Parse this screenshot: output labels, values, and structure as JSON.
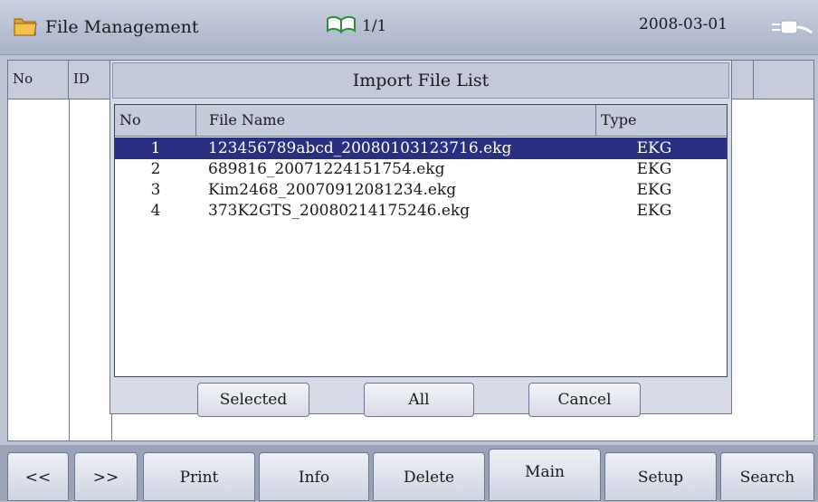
{
  "header": {
    "title": "File Management",
    "page_indicator": "1/1",
    "date": "2008-03-01",
    "icons": [
      "folder-icon",
      "book-icon",
      "power-plug-icon"
    ]
  },
  "background_table": {
    "columns": [
      "No",
      "ID",
      "",
      ""
    ]
  },
  "dialog": {
    "title": "Import File List",
    "columns": [
      "No",
      "File Name",
      "Type"
    ],
    "rows": [
      {
        "no": "1",
        "name": "123456789abcd_20080103123716.ekg",
        "type": "EKG",
        "selected": true
      },
      {
        "no": "2",
        "name": "689816_20071224151754.ekg",
        "type": "EKG",
        "selected": false
      },
      {
        "no": "3",
        "name": "Kim2468_20070912081234.ekg",
        "type": "EKG",
        "selected": false
      },
      {
        "no": "4",
        "name": "373K2GTS_20080214175246.ekg",
        "type": "EKG",
        "selected": false
      }
    ],
    "buttons": {
      "selected": "Selected",
      "all": "All",
      "cancel": "Cancel"
    }
  },
  "bottom_buttons": [
    "<<",
    ">>",
    "Print",
    "Info",
    "Delete",
    "Main",
    "Setup",
    "Search"
  ],
  "colors": {
    "selection": "#2b2f82",
    "bar_background": "#bcc3d3"
  }
}
